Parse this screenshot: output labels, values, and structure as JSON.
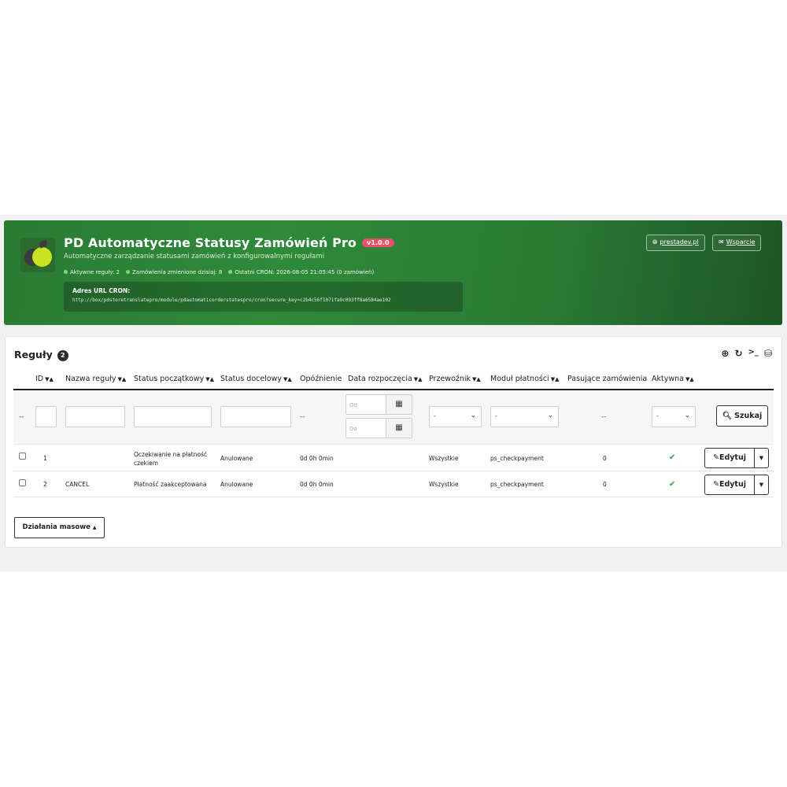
{
  "header": {
    "title": "PD Automatyczne Statusy Zamówień Pro",
    "version": "v1.0.0",
    "subtitle": "Automatyczne zarządzanie statusami zamówień z konfigurowalnymi regułami",
    "stats": [
      "Aktywne reguły: 2",
      "Zamówienia zmienione dzisiaj: 8",
      "Ostatni CRON: 2026-08-05 21:05:45 (0 zamówień)"
    ],
    "cron_label": "Adres URL CRON:",
    "cron_url": "http://box/pdstoretranslatepro/module/pdautomaticorderstatespro/cron?secure_key=c2b4c56f1071fa9c093ff8a6584ae102",
    "links": {
      "website": "prestadev.pl",
      "support": "Wsparcie"
    }
  },
  "panel": {
    "title": "Reguły",
    "count": "2",
    "columns": {
      "id": "ID",
      "name": "Nazwa reguły",
      "status_from": "Status początkowy",
      "status_to": "Status docelowy",
      "delay": "Opóźnienie",
      "start_date": "Data rozpoczęcia",
      "carrier": "Przewoźnik",
      "payment": "Moduł płatności",
      "matching": "Pasujące zamówienia",
      "active": "Aktywna"
    },
    "filters": {
      "empty_dash": "--",
      "date_from_placeholder": "Od",
      "date_to_placeholder": "Do",
      "select_default": "-",
      "search_label": "Szukaj"
    },
    "rows": [
      {
        "id": "1",
        "name": "",
        "status_from": "Oczekiwanie na płatność czekiem",
        "status_to": "Anulowane",
        "delay": "0d 0h 0min",
        "start_date": "",
        "carrier": "Wszystkie",
        "payment": "ps_checkpayment",
        "matching": "0",
        "active": true
      },
      {
        "id": "2",
        "name": "CANCEL",
        "status_from": "Płatność zaakceptowana",
        "status_to": "Anulowane",
        "delay": "0d 0h 0min",
        "start_date": "",
        "carrier": "Wszystkie",
        "payment": "ps_checkpayment",
        "matching": "0",
        "active": true
      }
    ],
    "edit_label": "Edytuj",
    "bulk_label": "Działania masowe"
  },
  "colors": {
    "banner_green": "#2f8a3a",
    "badge_red": "#e8506b",
    "check_green": "#2f9e3e"
  },
  "icons": [
    "globe-icon",
    "envelope-icon",
    "plus-circle-icon",
    "refresh-icon",
    "terminal-icon",
    "database-icon",
    "search-icon",
    "calendar-icon",
    "pencil-icon",
    "check-icon",
    "caret-down-icon"
  ]
}
